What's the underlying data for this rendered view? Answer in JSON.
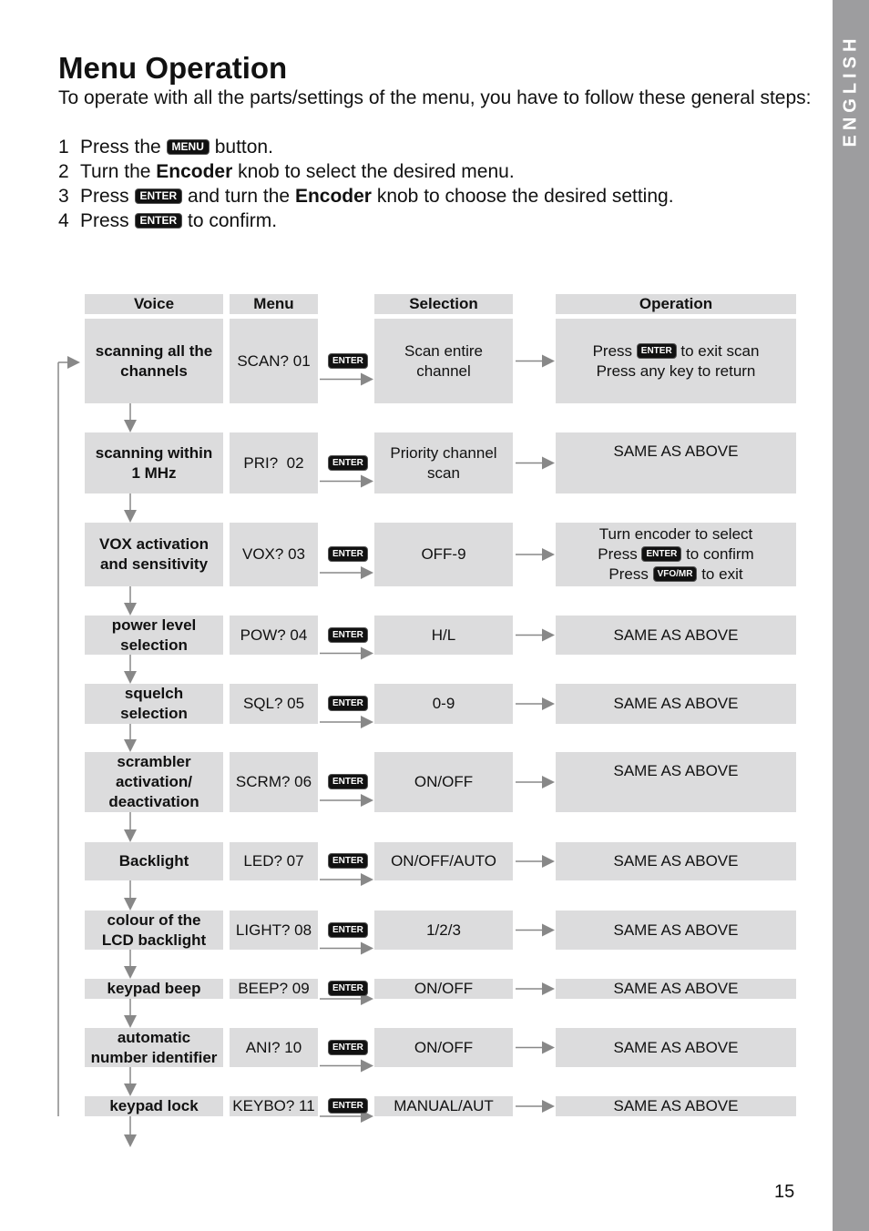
{
  "side_tab": "ENGLISH",
  "title": "Menu Operation",
  "intro": "To operate with all the parts/settings of the menu, you have to follow these general steps:",
  "steps": [
    {
      "n": "1",
      "parts": [
        "Press the ",
        {
          "key": "MENU"
        },
        " button."
      ]
    },
    {
      "n": "2",
      "parts": [
        "Turn the ",
        {
          "b": "Encoder"
        },
        " knob to select the desired menu."
      ]
    },
    {
      "n": "3",
      "parts": [
        "Press ",
        {
          "key": "ENTER"
        },
        " and turn the ",
        {
          "b": "Encoder"
        },
        " knob to choose the desired setting."
      ]
    },
    {
      "n": "4",
      "parts": [
        "Press ",
        {
          "key": "ENTER"
        },
        " to confirm."
      ]
    }
  ],
  "table": {
    "headers": [
      "Voice",
      "Menu",
      "Selection",
      "Operation"
    ],
    "enter_key": "ENTER",
    "rows": [
      {
        "voice": "scanning all the channels",
        "menu": "SCAN? 01",
        "selection": "Scan entire channel",
        "operation": [
          "Press ",
          {
            "key": "ENTER"
          },
          " to exit scan",
          "<br>",
          "Press any key to return"
        ]
      },
      {
        "voice": "scanning within 1 MHz",
        "menu": "PRI?  02",
        "selection": "Priority channel scan",
        "operation": [
          "SAME AS ABOVE"
        ]
      },
      {
        "voice": "VOX activation and sensitivity",
        "menu": "VOX? 03",
        "selection": "OFF-9",
        "operation": [
          "Turn encoder to select",
          "<br>",
          "Press ",
          {
            "key": "ENTER"
          },
          " to confirm",
          "<br>",
          "Press ",
          {
            "key": "VFO/MR"
          },
          " to exit"
        ]
      },
      {
        "voice": "power level selection",
        "menu": "POW? 04",
        "selection": "H/L",
        "operation": [
          "SAME AS ABOVE"
        ]
      },
      {
        "voice": "squelch selection",
        "menu": "SQL? 05",
        "selection": "0-9",
        "operation": [
          "SAME AS ABOVE"
        ]
      },
      {
        "voice": "scrambler activation/ deactivation",
        "menu": "SCRM? 06",
        "selection": "ON/OFF",
        "operation": [
          "SAME AS ABOVE"
        ]
      },
      {
        "voice": "Backlight",
        "menu": "LED? 07",
        "selection": "ON/OFF/AUTO",
        "operation": [
          "SAME AS ABOVE"
        ]
      },
      {
        "voice": "colour of the LCD backlight",
        "menu": "LIGHT? 08",
        "selection": "1/2/3",
        "operation": [
          "SAME AS ABOVE"
        ]
      },
      {
        "voice": "keypad beep",
        "menu": "BEEP? 09",
        "selection": "ON/OFF",
        "operation": [
          "SAME AS ABOVE"
        ]
      },
      {
        "voice": "automatic number identifier",
        "menu": "ANI? 10",
        "selection": "ON/OFF",
        "operation": [
          "SAME AS ABOVE"
        ]
      },
      {
        "voice": "keypad lock",
        "menu": "KEYBO? 11",
        "selection": "MANUAL/AUT",
        "operation": [
          "SAME AS ABOVE"
        ]
      }
    ]
  },
  "page_number": "15",
  "colors": {
    "cell": "#dcdcdd",
    "side_tab": "#9d9d9f",
    "arrow": "#888888"
  }
}
